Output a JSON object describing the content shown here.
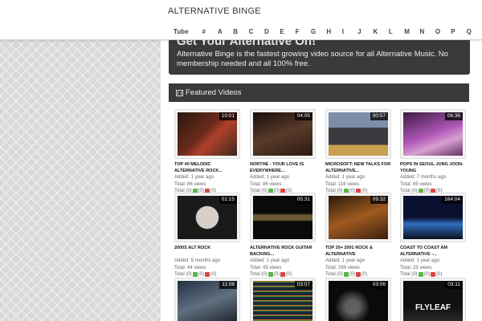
{
  "header": {
    "brand": "ALTERNATIVE BINGE",
    "tube_label": "Tube",
    "letters": [
      "#",
      "A",
      "B",
      "C",
      "D",
      "E",
      "F",
      "G",
      "H",
      "I",
      "J",
      "K",
      "L",
      "M",
      "N",
      "O",
      "P",
      "Q"
    ]
  },
  "hero": {
    "title": "Get Your Alternative On!",
    "description": "Alternative Binge is the fastest growing video source for all Alternative Music. No membership needed and all 100% free."
  },
  "featured": {
    "heading": "Featured Videos",
    "videos": [
      {
        "title": "TOP 40 MELODIC ALTERNATIVE ROCK...",
        "duration": "10:01",
        "added": "Added: 1 year ago",
        "views": "Total: 86 views",
        "total_label": "Total (0)",
        "likes": "(0)",
        "dislikes": "(0)",
        "icon": "thumbnail-red-car"
      },
      {
        "title": "NORTHE - YOUR LOVE IS EVERYWHERE...",
        "duration": "04:05",
        "added": "Added: 1 year ago",
        "views": "Total: 86 views",
        "total_label": "Total (0)",
        "likes": "(0)",
        "dislikes": "(0)",
        "icon": "thumbnail-guitarist"
      },
      {
        "title": "MICROSOFT: NEW TALKS FOR ALTERNATIVE...",
        "duration": "00:57",
        "added": "Added: 1 year ago",
        "views": "Total: 116 views",
        "total_label": "Total (0)",
        "likes": "(0)",
        "dislikes": "(0)",
        "icon": "thumbnail-podium"
      },
      {
        "title": "POPS IN SEOUL-JUNG JOON-YOUNG",
        "duration": "06:36",
        "added": "Added: 7 months ago",
        "views": "Total: 65 views",
        "total_label": "Total (0)",
        "likes": "(0)",
        "dislikes": "(0)",
        "icon": "thumbnail-stage-pink"
      },
      {
        "title": "2000S ALT ROCK",
        "duration": "01:15",
        "added": "Added: 5 months ago",
        "views": "Total: 44 views",
        "total_label": "Total (0)",
        "likes": "(0)",
        "dislikes": "(0)",
        "icon": "thumbnail-singer"
      },
      {
        "title": "ALTERNATIVE ROCK GUITAR BACKING...",
        "duration": "05:31",
        "added": "Added: 1 year ago",
        "views": "Total: 43 views",
        "total_label": "Total (0)",
        "likes": "(0)",
        "dislikes": "(0)",
        "icon": "thumbnail-guitar-neck"
      },
      {
        "title": "TOP 20+ 2001 ROCK & ALTERNATIVE",
        "duration": "09:32",
        "added": "Added: 1 year ago",
        "views": "Total: 289 views",
        "total_label": "Total (0)",
        "likes": "(0)",
        "dislikes": "(0)",
        "icon": "thumbnail-band"
      },
      {
        "title": "COAST TO COAST AM ALTERNATIVE -...",
        "duration": "164:04",
        "added": "Added: 1 year ago",
        "views": "Total: 25 views",
        "total_label": "Total (0)",
        "likes": "(0)",
        "dislikes": "(0)",
        "icon": "thumbnail-city-night"
      },
      {
        "title": "",
        "duration": "11:08",
        "added": "",
        "views": "",
        "total_label": "",
        "likes": "",
        "dislikes": "",
        "icon": "thumbnail-band-poster"
      },
      {
        "title": "",
        "duration": "03:07",
        "added": "",
        "views": "",
        "total_label": "",
        "likes": "",
        "dislikes": "",
        "icon": "thumbnail-daw"
      },
      {
        "title": "",
        "duration": "03:06",
        "added": "",
        "views": "",
        "total_label": "",
        "likes": "",
        "dislikes": "",
        "icon": "thumbnail-dark-figure"
      },
      {
        "title": "",
        "duration": "03:11",
        "added": "",
        "views": "",
        "total_label": "",
        "likes": "",
        "dislikes": "",
        "icon": "thumbnail-flyleaf",
        "thumb_text": "FLYLEAF"
      }
    ]
  }
}
